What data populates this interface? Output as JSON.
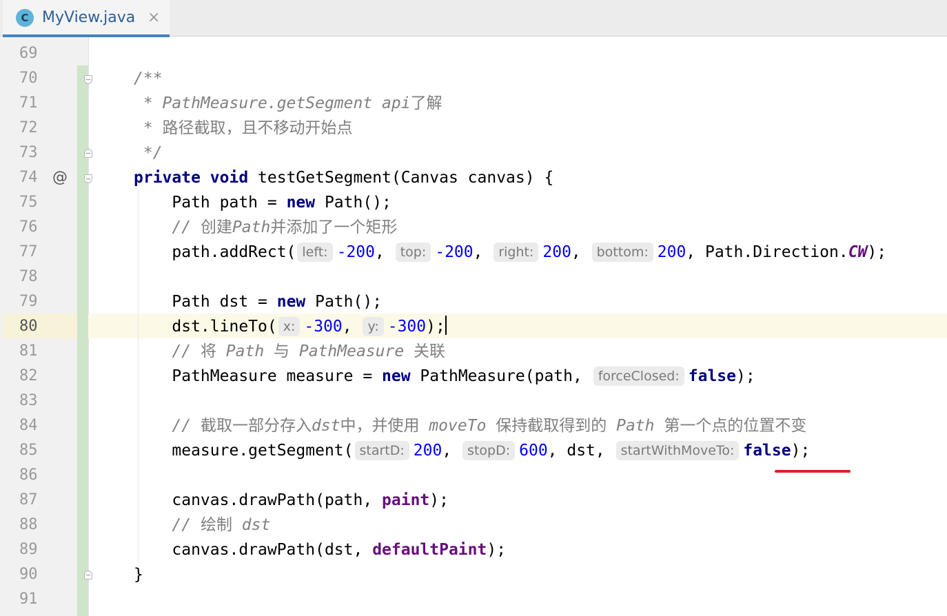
{
  "tab": {
    "icon_letter": "C",
    "title": "MyView.java",
    "close_glyph": "×"
  },
  "gutter": {
    "override_marker": "@"
  },
  "editor": {
    "current_line": 80,
    "lines": [
      {
        "number": "69"
      },
      {
        "number": "70"
      },
      {
        "number": "71"
      },
      {
        "number": "72"
      },
      {
        "number": "73"
      },
      {
        "number": "74"
      },
      {
        "number": "75"
      },
      {
        "number": "76"
      },
      {
        "number": "77"
      },
      {
        "number": "78"
      },
      {
        "number": "79"
      },
      {
        "number": "80"
      },
      {
        "number": "81"
      },
      {
        "number": "82"
      },
      {
        "number": "83"
      },
      {
        "number": "84"
      },
      {
        "number": "85"
      },
      {
        "number": "86"
      },
      {
        "number": "87"
      },
      {
        "number": "88"
      },
      {
        "number": "89"
      },
      {
        "number": "90"
      },
      {
        "number": "91"
      }
    ],
    "code": {
      "l70": "/**",
      "l71_a": " * PathMeasure.getSegment api",
      "l71_b": "了解",
      "l72_a": " * ",
      "l72_b": "路径截取，且不移动开始点",
      "l73": " */",
      "l74_kw1": "private",
      "l74_kw2": "void",
      "l74_rest": " testGetSegment(Canvas canvas) {",
      "l75_a": "    Path path = ",
      "l75_kw": "new",
      "l75_b": " Path();",
      "l76_a": "    // ",
      "l76_b": "创建",
      "l76_c": "Path",
      "l76_d": "并添加了一个矩形",
      "l77_a": "    path.addRect(",
      "l77_h1": "left:",
      "l77_n1": "-200",
      "l77_s1": ", ",
      "l77_h2": "top:",
      "l77_n2": "-200",
      "l77_s2": ", ",
      "l77_h3": "right:",
      "l77_n3": "200",
      "l77_s3": ", ",
      "l77_h4": "bottom:",
      "l77_n4": "200",
      "l77_s4": ", Path.Direction.",
      "l77_c": "CW",
      "l77_e": ");",
      "l79_a": "    Path dst = ",
      "l79_kw": "new",
      "l79_b": " Path();",
      "l80_a": "    dst.lineTo(",
      "l80_h1": "x:",
      "l80_n1": "-300",
      "l80_s1": ", ",
      "l80_h2": "y:",
      "l80_n2": "-300",
      "l80_e": ");",
      "l81_a": "    // ",
      "l81_b": "将",
      "l81_c": " Path ",
      "l81_d": "与",
      "l81_e": " PathMeasure ",
      "l81_f": "关联",
      "l82_a": "    PathMeasure measure = ",
      "l82_kw": "new",
      "l82_b": " PathMeasure(path, ",
      "l82_h": "forceClosed:",
      "l82_kw2": "false",
      "l82_e": ");",
      "l84_a": "    // ",
      "l84_b": "截取一部分存入",
      "l84_c": "dst",
      "l84_d": "中，并使用",
      "l84_e": " moveTo ",
      "l84_f": "保持截取得到的",
      "l84_g": " Path ",
      "l84_h": "第一个点的位置不变",
      "l85_a": "    measure.getSegment(",
      "l85_h1": "startD:",
      "l85_n1": "200",
      "l85_s1": ", ",
      "l85_h2": "stopD:",
      "l85_n2": "600",
      "l85_s2": ", dst, ",
      "l85_h3": "startWithMoveTo:",
      "l85_kw": "false",
      "l85_e": ");",
      "l87_a": "    canvas.drawPath(path, ",
      "l87_f": "paint",
      "l87_e": ");",
      "l88_a": "    // ",
      "l88_b": "绘制",
      "l88_c": " dst",
      "l89_a": "    canvas.drawPath(dst, ",
      "l89_f": "defaultPaint",
      "l89_e": ");",
      "l90": "}"
    }
  },
  "annotation": {
    "color": "#e02020"
  }
}
